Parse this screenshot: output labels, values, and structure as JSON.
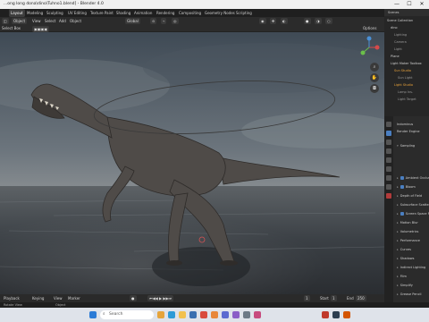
{
  "window": {
    "title": "...ong long dona\\dino\\Tuhno1.blend] - Blender 4.0",
    "controls": [
      "—",
      "☐",
      "✕"
    ]
  },
  "menubar": {
    "items": [
      "Layout",
      "Modeling",
      "Sculpting",
      "UV Editing",
      "Texture Paint",
      "Shading",
      "Animation",
      "Rendering",
      "Compositing",
      "Geometry Nodes",
      "Scripting"
    ],
    "active": "Layout"
  },
  "viewport_header": {
    "mode": "Object",
    "view": "View",
    "select": "Select",
    "add": "Add",
    "object": "Object",
    "orientation": "Global",
    "transform": "Default",
    "drag": "Select Box",
    "options": "Options"
  },
  "viewport_header2": {
    "label": "Select Box"
  },
  "timeline": {
    "playback": "Playback",
    "keying": "Keying",
    "view": "View",
    "marker": "Marker",
    "start_label": "Start",
    "start": "1",
    "end_label": "End",
    "end": "250",
    "frame": "1"
  },
  "statusbar": {
    "left": "Rotate View",
    "mid": "Object"
  },
  "outliner": {
    "header": "Scenes",
    "items": [
      {
        "label": "Scene Collection",
        "indent": 0,
        "color": "#cfcfcf"
      },
      {
        "label": "dino",
        "indent": 1,
        "color": "#cfcfcf"
      },
      {
        "label": "Lighting",
        "indent": 2,
        "color": "#9a9a9a"
      },
      {
        "label": "Camera",
        "indent": 2,
        "color": "#9a9a9a"
      },
      {
        "label": "Light",
        "indent": 2,
        "color": "#9a9a9a"
      },
      {
        "label": "Plane",
        "indent": 1,
        "color": "#cfcfcf"
      },
      {
        "label": "Light Maker Toolbox",
        "indent": 1,
        "color": "#cfcfcf"
      },
      {
        "label": "Sun Studio",
        "indent": 2,
        "color": "#e8a23a"
      },
      {
        "label": "Sun Light",
        "indent": 3,
        "color": "#9a9a9a"
      },
      {
        "label": "Light Studio",
        "indent": 2,
        "color": "#e8a23a"
      },
      {
        "label": "Lamp Ins.",
        "indent": 3,
        "color": "#9a9a9a"
      },
      {
        "label": "Light Target",
        "indent": 3,
        "color": "#9a9a9a"
      }
    ]
  },
  "properties": {
    "header": "Render",
    "scene_label": "Indominus",
    "render_engine_label": "Render Engine",
    "sampling": "Sampling",
    "rows": [
      {
        "label": "Ambient Occlusion",
        "checked": true
      },
      {
        "label": "Bloom",
        "checked": true
      },
      {
        "label": "Depth of Field",
        "checked": false
      },
      {
        "label": "Subsurface Scattering",
        "checked": false
      },
      {
        "label": "Screen Space Reflections",
        "checked": true
      },
      {
        "label": "Motion Blur",
        "checked": false
      },
      {
        "label": "Volumetrics",
        "checked": false
      },
      {
        "label": "Performance",
        "checked": false
      },
      {
        "label": "Curves",
        "checked": false
      },
      {
        "label": "Shadows",
        "checked": false
      },
      {
        "label": "Indirect Lighting",
        "checked": false
      },
      {
        "label": "Film",
        "checked": false
      },
      {
        "label": "Simplify",
        "checked": false
      },
      {
        "label": "Grease Pencil",
        "checked": false
      }
    ]
  },
  "taskbar": {
    "search_placeholder": "Search",
    "icons": [
      "windows-icon",
      "search-icon",
      "task-view-icon",
      "edge-icon",
      "explorer-icon",
      "store-icon",
      "chrome-icon",
      "blender-icon",
      "mail-icon",
      "photos-icon",
      "settings-icon",
      "app-icon"
    ]
  },
  "colors": {
    "accent": "#4a7fc1",
    "blender_orange": "#e8a23a"
  }
}
